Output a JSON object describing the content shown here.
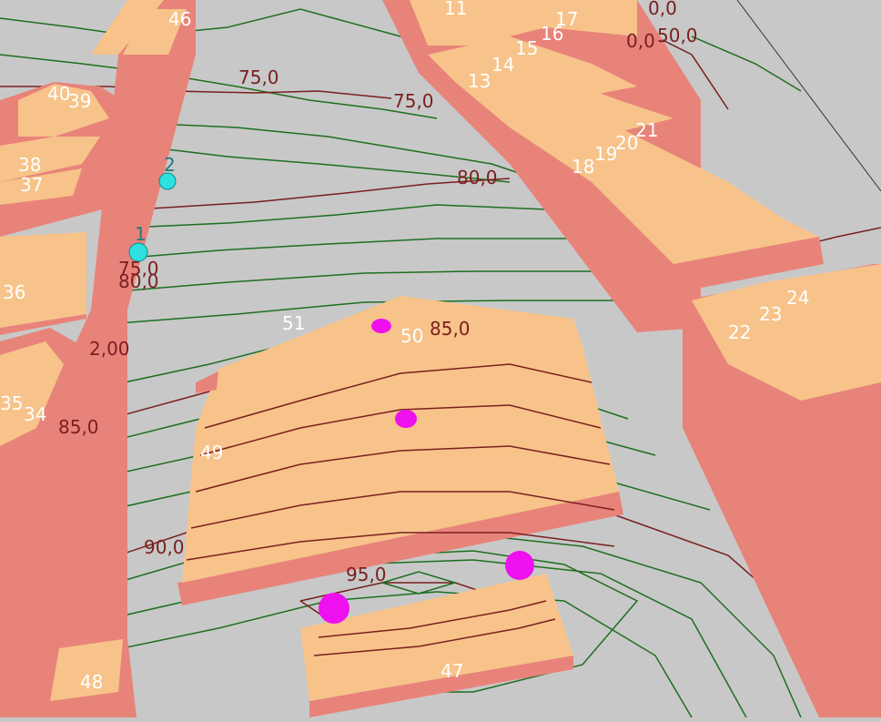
{
  "scene": {
    "background_color": "#c8c8c8",
    "building_top_color": "#f7c38a",
    "building_wall_color": "#e8837a",
    "contour_color_minor": "#1e6e1e",
    "contour_color_major": "#7a1f1f",
    "marker_magenta": "#ee10ee",
    "marker_cyan": "#2ee0e0"
  },
  "building_labels": {
    "b46": "46",
    "b11": "11",
    "b17": "17",
    "b16": "16",
    "b15": "15",
    "b14": "14",
    "b13": "13",
    "b40": "40",
    "b39": "39",
    "b38": "38",
    "b37": "37",
    "b36": "36",
    "b35": "35",
    "b34": "34",
    "b18": "18",
    "b19": "19",
    "b20": "20",
    "b21": "21",
    "b22": "22",
    "b23": "23",
    "b24": "24",
    "b51": "51",
    "b50": "50",
    "b49": "49",
    "b48": "48",
    "b47": "47"
  },
  "contour_labels": {
    "c75a": "75,0",
    "c75b": "75,0",
    "c80": "80,0",
    "c85a": "85,0",
    "c85b": "85,0",
    "c90": "90,0",
    "c95": "95,0",
    "c50top": "50,0",
    "c0top": "0,0",
    "c0top2": "0,0",
    "cleft1": "75,0",
    "cleft2": "80,0",
    "cleft3": "2,00"
  },
  "point_labels": {
    "p1": "1",
    "p2": "2"
  }
}
